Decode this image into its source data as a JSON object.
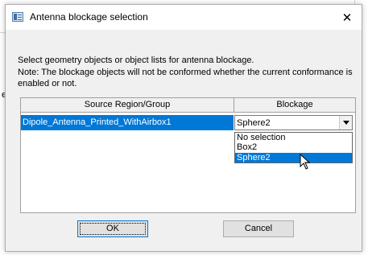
{
  "dialog": {
    "title": "Antenna blockage selection",
    "close_glyph": "✕",
    "instruction_1": "Select geometry objects or object lists for antenna blockage.",
    "instruction_2": "Note: The blockage objects will not be conformed whether the current conformance is enabled or not."
  },
  "background": {
    "left_fragment": "e"
  },
  "grid": {
    "columns": [
      "Source Region/Group",
      "Blockage"
    ],
    "rows": [
      {
        "source": "Dipole_Antenna_Printed_WithAirbox1",
        "blockage": "Sphere2"
      }
    ]
  },
  "dropdown": {
    "options": [
      "No selection",
      "Box2",
      "Sphere2"
    ],
    "selected": "Sphere2"
  },
  "buttons": {
    "ok": "OK",
    "cancel": "Cancel"
  },
  "colors": {
    "selection": "#0078d7",
    "dialog_bg": "#f0f0f0"
  }
}
